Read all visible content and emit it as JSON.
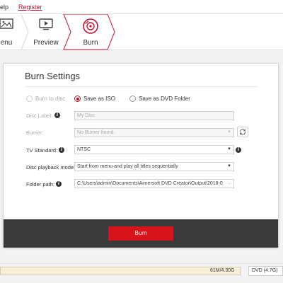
{
  "menu": {
    "help": "elp",
    "register": "Register"
  },
  "steps": [
    {
      "label": "enu",
      "icon": "menu-template-icon"
    },
    {
      "label": "Preview",
      "icon": "preview-icon"
    },
    {
      "label": "Burn",
      "icon": "burn-disc-icon",
      "active": true
    }
  ],
  "panel": {
    "title": "Burn Settings",
    "options": {
      "burn_to_disc": "Burn to disc",
      "save_as_iso": "Save as ISO",
      "save_as_dvd_folder": "Save as DVD Folder",
      "selected": "save_as_iso"
    },
    "disc_label": {
      "label": "Disc Label:",
      "value": "My Disc"
    },
    "burner": {
      "label": "Burner:",
      "value": "No Burner found."
    },
    "tv_standard": {
      "label": "TV Standard:",
      "value": "NTSC"
    },
    "playback_mode": {
      "label": "Disc playback mode:",
      "value": "Start from menu and play all titles sequentially"
    },
    "folder_path": {
      "label": "Folder path:",
      "value": "C:\\Users\\admin\\Documents\\Aimersoft DVD Creator\\Output\\2018-0"
    },
    "burn_button": "Burn"
  },
  "status": {
    "capacity": "61M/4.30G",
    "disc_type": "DVD (4.7G)"
  },
  "colors": {
    "accent": "#d7141c",
    "footer": "#3a3a3a"
  }
}
